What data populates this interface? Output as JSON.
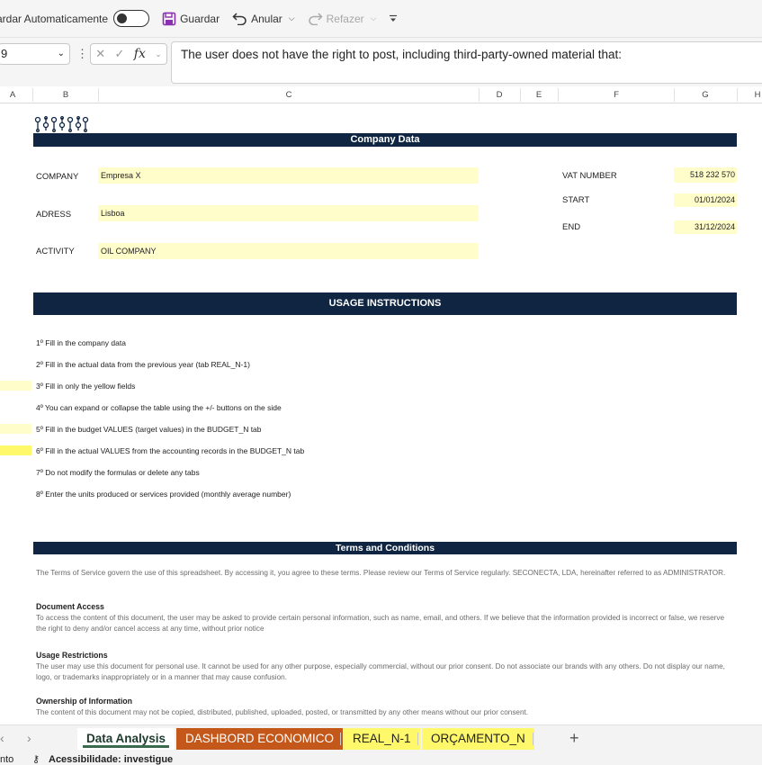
{
  "toolbar": {
    "autosave_label": "ardar Automaticamente",
    "save_label": "Guardar",
    "undo_label": "Anular",
    "redo_label": "Refazer"
  },
  "formula_bar": {
    "name_box": "9",
    "fx_label": "fx",
    "content": "The user does not have the right to post, including third-party-owned material that:"
  },
  "columns": [
    "A",
    "B",
    "C",
    "D",
    "E",
    "F",
    "G",
    "H"
  ],
  "company": {
    "section_title": "Company Data",
    "company_label": "COMPANY",
    "company_value": "Empresa X",
    "address_label": "ADRESS",
    "address_value": "Lisboa",
    "activity_label": "ACTIVITY",
    "activity_value": "OIL COMPANY",
    "vat_label": "VAT NUMBER",
    "vat_value": "518 232 570",
    "start_label": "START",
    "start_value": "01/01/2024",
    "end_label": "END",
    "end_value": "31/12/2024"
  },
  "instructions": {
    "title": "USAGE INSTRUCTIONS",
    "items": [
      "1º Fill in the company data",
      "2º Fill in the actual data from the previous year (tab REAL_N-1)",
      "3º Fill in only the yellow fields",
      "4º You can expand or collapse the table using the +/- buttons on the side",
      "5º Fill in the budget VALUES (target values) in the BUDGET_N tab",
      "6º Fill in the actual VALUES from the accounting records in the BUDGET_N tab",
      "7º Do not modify the formulas or delete any tabs",
      "8º Enter the units produced or services provided (monthly average number)"
    ]
  },
  "terms": {
    "title": "Terms and Conditions",
    "intro": "The Terms of Service govern the use of this spreadsheet. By accessing it, you agree to these terms. Please review our Terms of Service regularly. SECONECTA, LDA, hereinafter referred to as ADMINISTRATOR.",
    "doc_access_title": "Document Access",
    "doc_access_text": "To access the content of this document, the user may be asked to provide certain personal information, such as name, email, and others. If we believe that the information provided is incorrect or false, we reserve the right to deny and/or cancel access at any time, without prior notice",
    "usage_title": "Usage Restrictions",
    "usage_text": "The user may use this document for personal use. It cannot be used for any other purpose, especially commercial, without our prior consent. Do not associate our brands with any others. Do not display our name, logo, or trademarks inappropriately or in a manner that may cause confusion.",
    "ownership_title": "Ownership of Information",
    "ownership_text": "The content of this document may not be copied, distributed, published, uploaded, posted, or transmitted by any other means without our prior consent."
  },
  "sheet_tabs": [
    {
      "label": "Data Analysis",
      "style": "active"
    },
    {
      "label": "DASHBORD ECONOMICO",
      "style": "orange"
    },
    {
      "label": "REAL_N-1",
      "style": "yellow"
    },
    {
      "label": "ORÇAMENTO_N",
      "style": "yellow"
    }
  ],
  "status_bar": {
    "left_text": "nto",
    "accessibility": "Acessibilidade: investigue"
  },
  "colors": {
    "header_band": "#0f2541",
    "input_fill": "#fffdc9",
    "tab_orange": "#c4581b",
    "tab_yellow": "#fff86b"
  }
}
